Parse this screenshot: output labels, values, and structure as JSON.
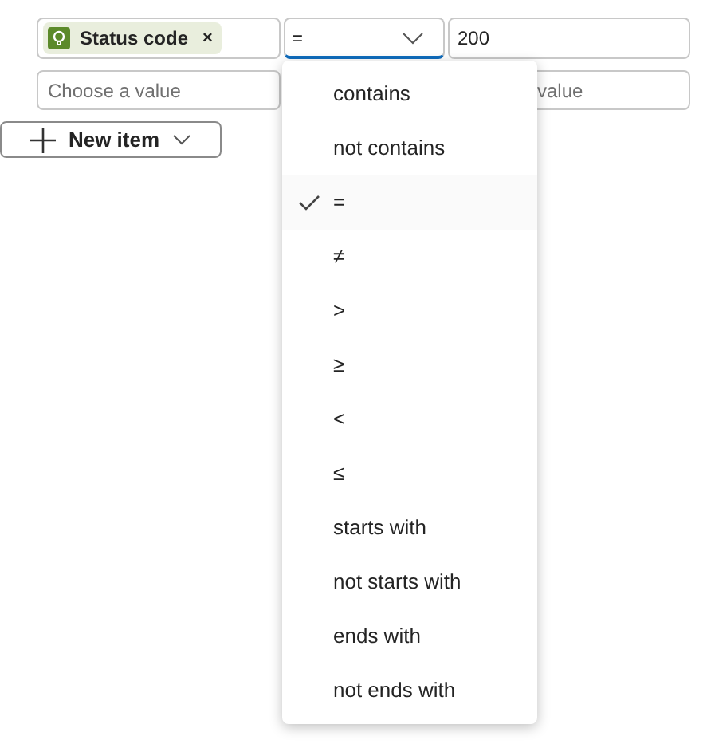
{
  "condition": {
    "field_tag": {
      "label": "Status code",
      "remove": "×"
    },
    "operator": {
      "value": "="
    },
    "value": {
      "value": "200"
    }
  },
  "second_row": {
    "left": {
      "placeholder": "Choose a value"
    },
    "right": {
      "placeholder": "value"
    }
  },
  "new_item_button": {
    "label": "New item"
  },
  "operator_menu": [
    {
      "label": "contains",
      "selected": false
    },
    {
      "label": "not contains",
      "selected": false
    },
    {
      "label": "=",
      "selected": true
    },
    {
      "label": "≠",
      "selected": false
    },
    {
      "label": ">",
      "selected": false
    },
    {
      "label": "≥",
      "selected": false
    },
    {
      "label": "<",
      "selected": false
    },
    {
      "label": "≤",
      "selected": false
    },
    {
      "label": "starts with",
      "selected": false
    },
    {
      "label": "not starts with",
      "selected": false
    },
    {
      "label": "ends with",
      "selected": false
    },
    {
      "label": "not ends with",
      "selected": false
    }
  ]
}
